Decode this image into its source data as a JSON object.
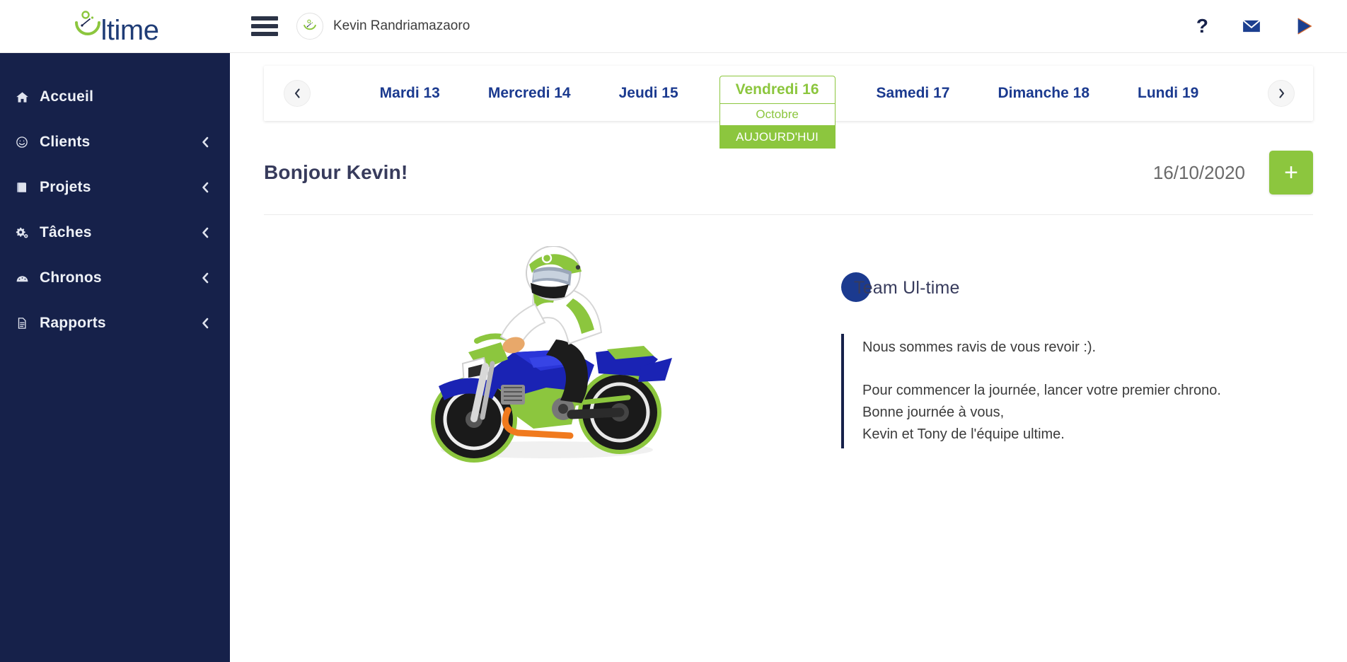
{
  "brand": {
    "name": "ltime",
    "logo_icon": "ultime-logo-icon",
    "avatar_label": "Ultime"
  },
  "sidebar": {
    "items": [
      {
        "label": "Accueil",
        "icon": "home-icon",
        "has_chevron": false
      },
      {
        "label": "Clients",
        "icon": "smiley-icon",
        "has_chevron": true
      },
      {
        "label": "Projets",
        "icon": "book-icon",
        "has_chevron": true
      },
      {
        "label": "Tâches",
        "icon": "gears-icon",
        "has_chevron": true
      },
      {
        "label": "Chronos",
        "icon": "speedometer-icon",
        "has_chevron": true
      },
      {
        "label": "Rapports",
        "icon": "document-icon",
        "has_chevron": true
      }
    ]
  },
  "topbar": {
    "menu_icon": "hamburger-menu-icon",
    "user_name": "Kevin Randriamazaoro",
    "icons": [
      {
        "name": "help-icon",
        "glyph": "?"
      },
      {
        "name": "mail-icon",
        "glyph": "envelope"
      },
      {
        "name": "send-icon",
        "glyph": "play-triangle"
      }
    ]
  },
  "daynav": {
    "prev_label": "‹",
    "next_label": "›",
    "days": [
      {
        "label": "Mardi 13",
        "selected": false
      },
      {
        "label": "Mercredi 14",
        "selected": false
      },
      {
        "label": "Jeudi 15",
        "selected": false
      },
      {
        "label": "Vendredi 16",
        "selected": true,
        "month": "Octobre",
        "today_label": "AUJOURD'HUI"
      },
      {
        "label": "Samedi 17",
        "selected": false
      },
      {
        "label": "Dimanche 18",
        "selected": false
      },
      {
        "label": "Lundi 19",
        "selected": false
      }
    ]
  },
  "greeting": {
    "title": "Bonjour Kevin!",
    "date": "16/10/2020",
    "add_label": "+"
  },
  "illustration": {
    "name": "motorcycle-rider-illustration"
  },
  "message": {
    "team_title": "Team Ul-time",
    "line1": "Nous sommes ravis de vous revoir :).",
    "line2": "Pour commencer la journée, lancer votre premier chrono.",
    "line3": "Bonne journée à vous,",
    "line4": "Kevin et Tony de l'équipe ultime."
  },
  "colors": {
    "sidebar_bg": "#16214a",
    "accent_green": "#8cc63e",
    "brand_blue": "#1b3a8f",
    "text_dark": "#373b5c"
  }
}
